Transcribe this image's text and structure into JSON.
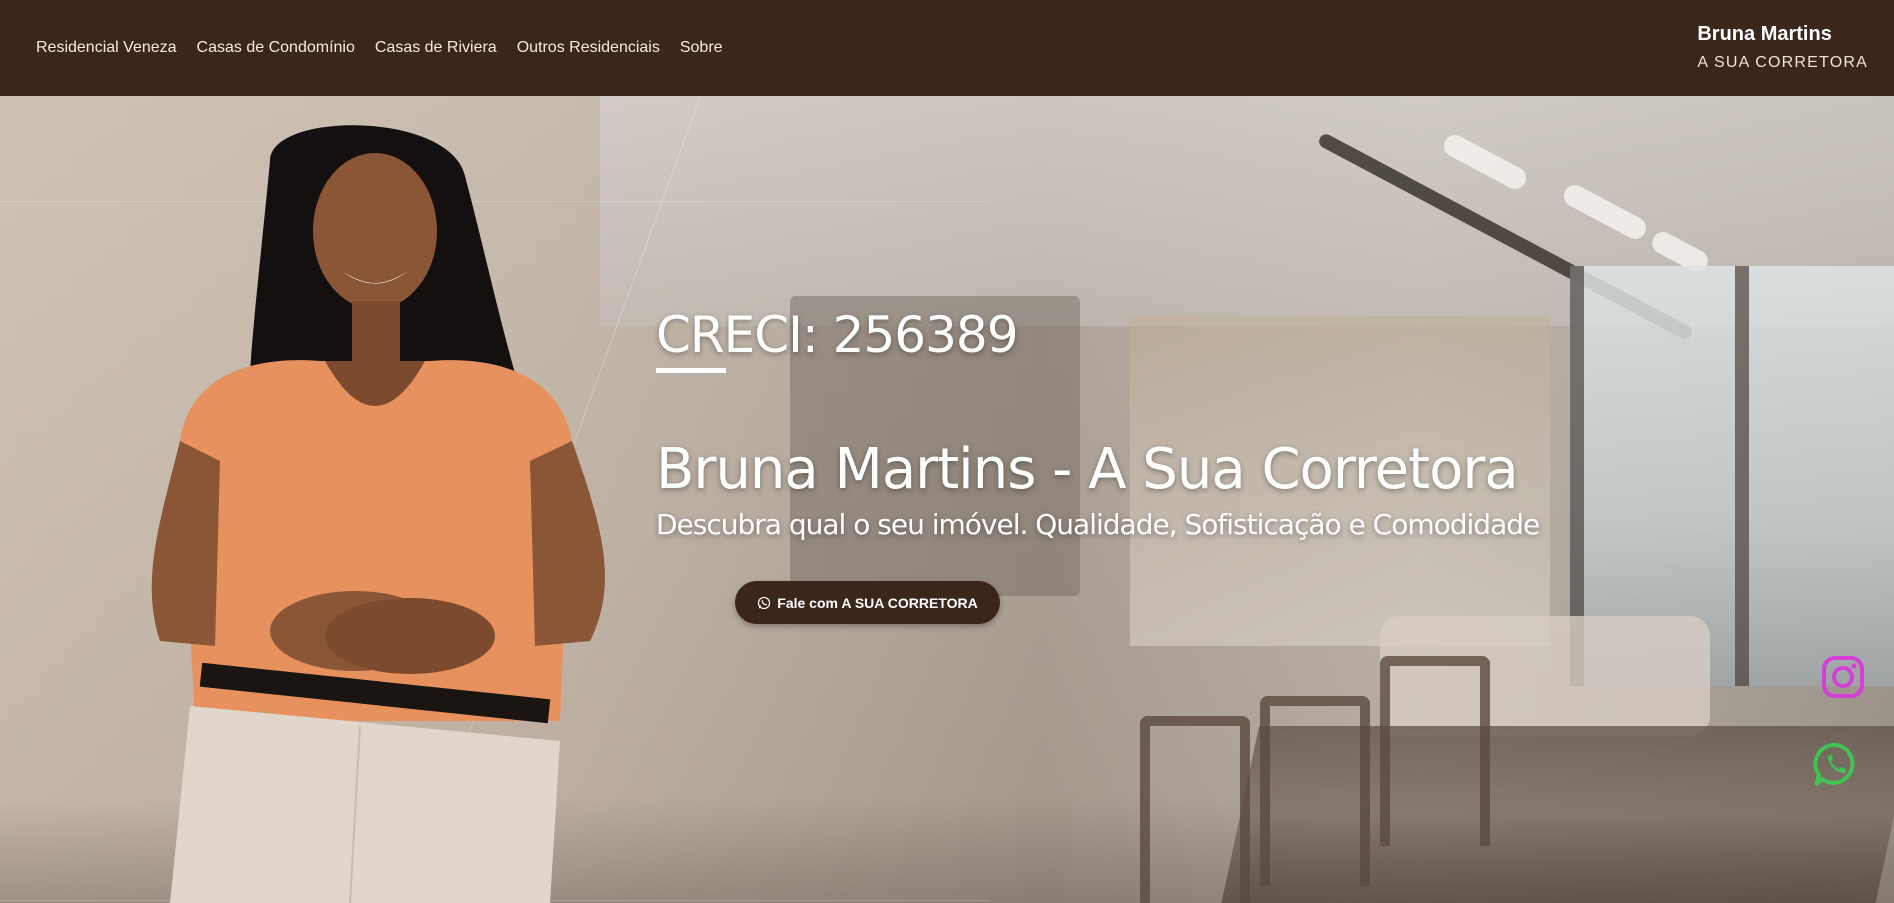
{
  "nav": {
    "items": [
      {
        "label": "Residencial Veneza"
      },
      {
        "label": "Casas de Condomínio"
      },
      {
        "label": "Casas de Riviera"
      },
      {
        "label": "Outros Residenciais"
      },
      {
        "label": "Sobre"
      }
    ],
    "brand_name": "Bruna Martins",
    "brand_sub": "A SUA CORRETORA"
  },
  "hero": {
    "creci": "CRECI: 256389",
    "headline": "Bruna Martins - A Sua Corretora",
    "subline": "Descubra qual o seu imóvel. Qualidade, Sofisticação e Comodidade",
    "cta_label": "Fale com A SUA CORRETORA"
  },
  "icons": {
    "cta": "whatsapp-icon",
    "social_1": "instagram-icon",
    "social_2": "whatsapp-icon"
  },
  "colors": {
    "navbar_bg": "#3a261b",
    "cta_bg": "#3a261b",
    "instagram": "#d43fd6",
    "whatsapp": "#40c351",
    "shirt": "#e7925e"
  }
}
